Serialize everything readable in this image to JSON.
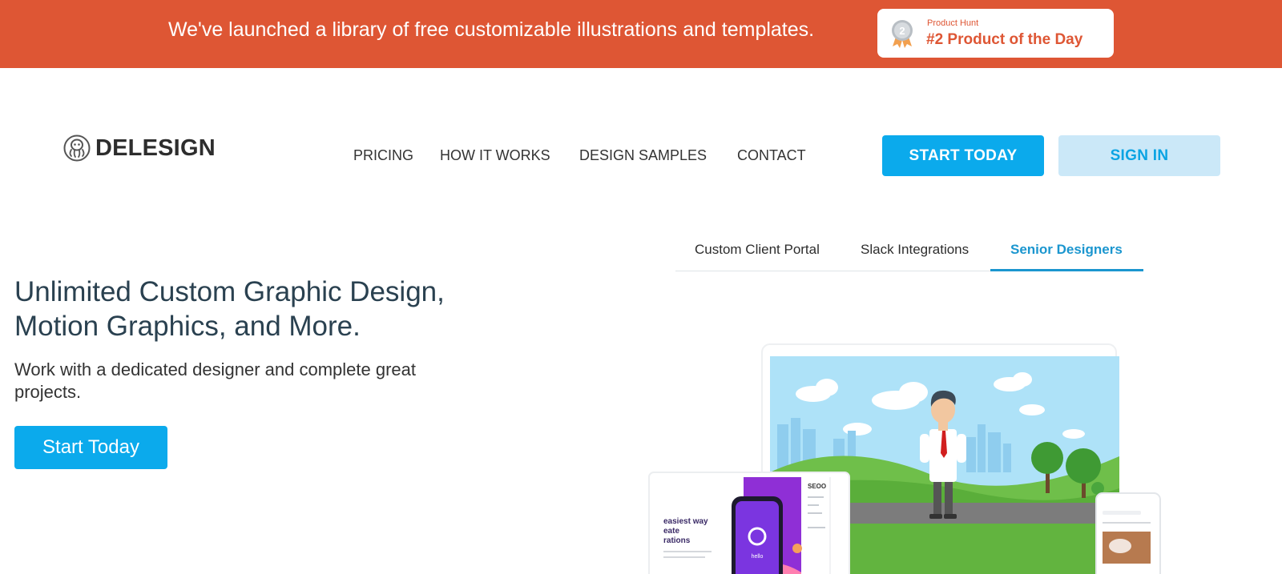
{
  "announcement": {
    "text": "We've launched a library of free customizable illustrations and templates.",
    "badge": {
      "small": "Product Hunt",
      "title": "#2 Product of the Day",
      "medal_icon": "medal-icon",
      "medal_number": "2"
    }
  },
  "header": {
    "logo_text": "DELESIGN",
    "logo_icon": "octopus-logo-icon",
    "nav": [
      "PRICING",
      "HOW IT WORKS",
      "DESIGN SAMPLES",
      "CONTACT"
    ],
    "start_today": "START TODAY",
    "sign_in": "SIGN IN"
  },
  "hero": {
    "title": "Unlimited Custom Graphic Design, Motion Graphics, and More.",
    "subtitle": "Work with a dedicated designer and complete great projects.",
    "cta": "Start Today"
  },
  "tabs": [
    {
      "label": "Custom Client Portal",
      "active": false
    },
    {
      "label": "Slack Integrations",
      "active": false
    },
    {
      "label": "Senior Designers",
      "active": true
    }
  ],
  "illustration": {
    "web_text": [
      "easiest way",
      "eate",
      "rations"
    ],
    "phone_text": "hello",
    "sidebar_text": "SEOO"
  },
  "colors": {
    "banner": "#de5634",
    "primary": "#0baaec",
    "secondary_bg": "#cbe8f8",
    "tab_active": "#1b96cf",
    "heading": "#2a4150"
  }
}
